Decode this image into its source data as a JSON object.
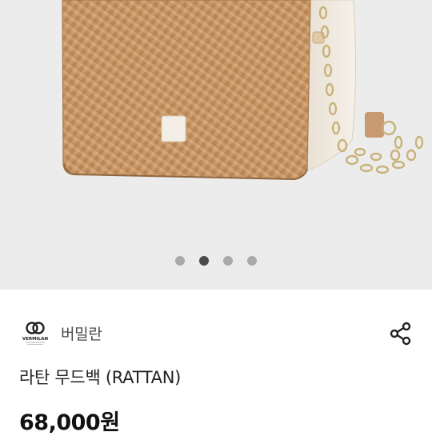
{
  "gallery": {
    "image_alt": "Rattan crossbody bag with gold chain strap",
    "dots": [
      {
        "active": false
      },
      {
        "active": true
      },
      {
        "active": false
      },
      {
        "active": false
      }
    ],
    "colors": {
      "background": "#ececec",
      "rattan": "#c9996a",
      "leather": "#ece4d8",
      "tab": "#f4efe6",
      "chain": "#c9b27a"
    }
  },
  "seller": {
    "name": "버밀란",
    "logo_text": "VERMILAN",
    "logo_icon": "vermilan-logo-icon"
  },
  "product": {
    "title": "라탄 무드백 (RATTAN)",
    "price": "68,000원"
  },
  "actions": {
    "share_icon": "share-icon"
  }
}
